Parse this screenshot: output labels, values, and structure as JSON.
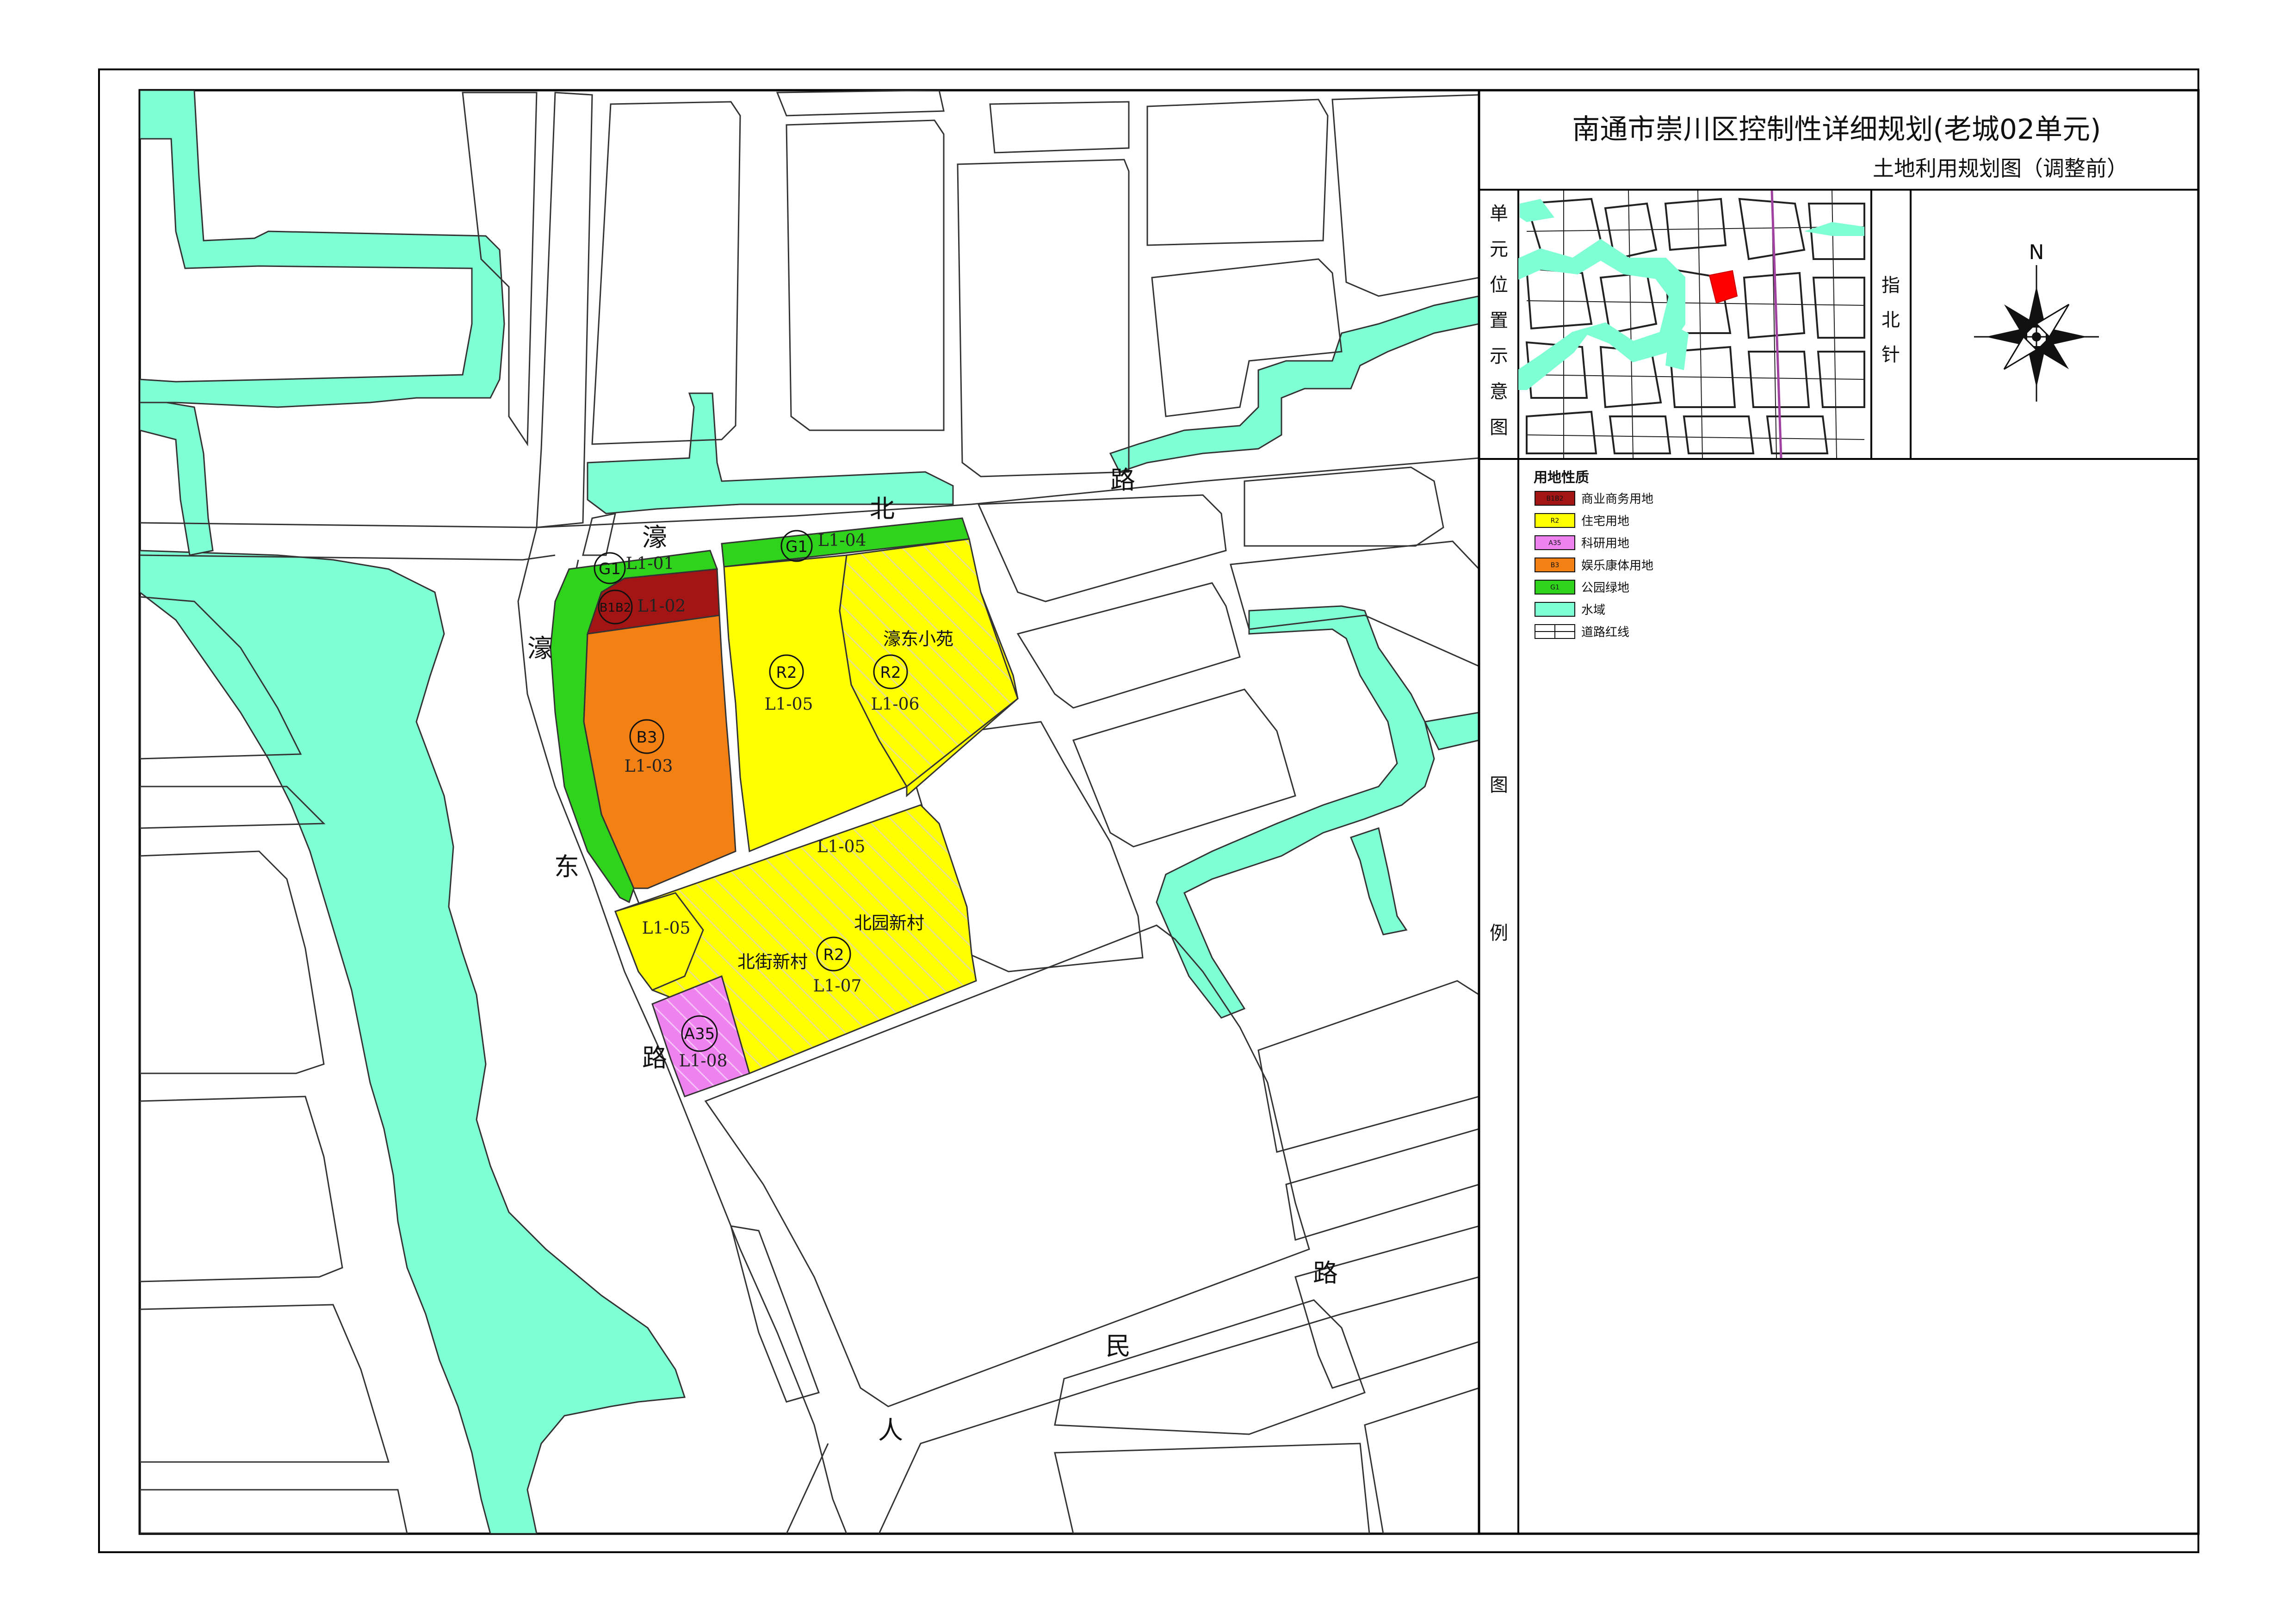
{
  "title": {
    "main": "南通市崇川区控制性详细规划(老城02单元)",
    "sub": "土地利用规划图（调整前）"
  },
  "side_labels": {
    "location": [
      "单",
      "元",
      "位",
      "置",
      "示",
      "意",
      "图"
    ],
    "north": [
      "指",
      "北",
      "针"
    ],
    "legend": [
      "图",
      "例"
    ]
  },
  "north_arrow": {
    "letter": "N"
  },
  "roads": {
    "haobei": [
      "濠",
      "北",
      "路"
    ],
    "haodong": [
      "濠",
      "东",
      "路"
    ],
    "renmin": [
      "人",
      "民",
      "路"
    ]
  },
  "neighborhoods": [
    "濠东小苑",
    "北园新村",
    "北街新村"
  ],
  "plots": [
    {
      "id": "L1-01",
      "type": "G1",
      "color": "#2fd31b"
    },
    {
      "id": "L1-02",
      "type": "B1B2",
      "color": "#a31515"
    },
    {
      "id": "L1-03",
      "type": "B3",
      "color": "#f28012"
    },
    {
      "id": "L1-04",
      "type": "G1",
      "color": "#2fd31b"
    },
    {
      "id": "L1-05",
      "type": "R2",
      "color": "#ffff00"
    },
    {
      "id": "L1-06",
      "type": "R2",
      "color": "#ffff00"
    },
    {
      "id": "L1-05",
      "type": "",
      "color": "#ffff00"
    },
    {
      "id": "L1-05",
      "type": "",
      "color": "#ffff00"
    },
    {
      "id": "L1-07",
      "type": "R2",
      "color": "#ffff00"
    },
    {
      "id": "L1-08",
      "type": "A35",
      "color": "#ee82ee"
    }
  ],
  "legend": {
    "title": "用地性质",
    "items": [
      {
        "code": "B1B2",
        "label": "商业商务用地",
        "color": "#a31515"
      },
      {
        "code": "R2",
        "label": "住宅用地",
        "color": "#ffff00"
      },
      {
        "code": "A35",
        "label": "科研用地",
        "color": "#ee82ee"
      },
      {
        "code": "B3",
        "label": "娱乐康体用地",
        "color": "#f28012"
      },
      {
        "code": "G1",
        "label": "公园绿地",
        "color": "#2fd31b"
      },
      {
        "code": "",
        "label": "水域",
        "color": "#7fffd4"
      },
      {
        "code": "",
        "label": "道路红线",
        "color": "#ffffff"
      }
    ]
  },
  "colors": {
    "water": "#7fffd4",
    "residential": "#ffff00",
    "green": "#2fd31b",
    "commercial": "#a31515",
    "recreation": "#f28012",
    "research": "#ee82ee",
    "highlight": "#ff0000"
  }
}
